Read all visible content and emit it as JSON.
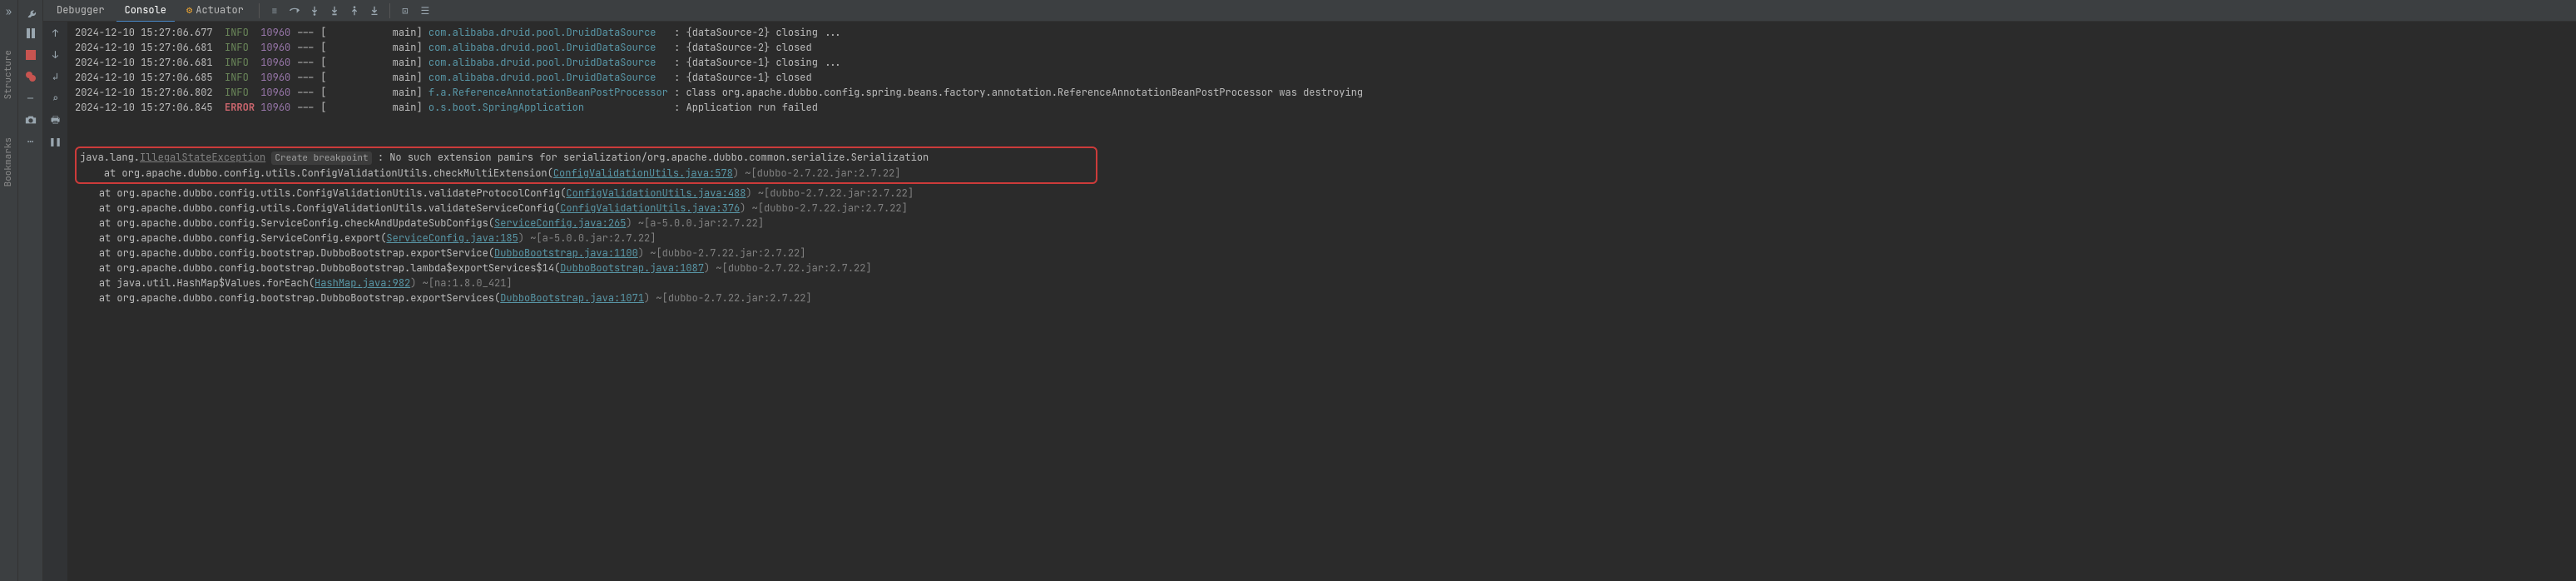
{
  "sidebar_vertical": {
    "structure": "Structure",
    "bookmarks": "Bookmarks"
  },
  "tabs": {
    "debugger": "Debugger",
    "console": "Console",
    "actuator": "Actuator"
  },
  "log": [
    {
      "ts": "2024-12-10 15:27:06.677",
      "level": "INFO",
      "pid": "10960",
      "thread": "main",
      "logger": "com.alibaba.druid.pool.DruidDataSource",
      "msg": "{dataSource-2} closing ..."
    },
    {
      "ts": "2024-12-10 15:27:06.681",
      "level": "INFO",
      "pid": "10960",
      "thread": "main",
      "logger": "com.alibaba.druid.pool.DruidDataSource",
      "msg": "{dataSource-2} closed"
    },
    {
      "ts": "2024-12-10 15:27:06.681",
      "level": "INFO",
      "pid": "10960",
      "thread": "main",
      "logger": "com.alibaba.druid.pool.DruidDataSource",
      "msg": "{dataSource-1} closing ..."
    },
    {
      "ts": "2024-12-10 15:27:06.685",
      "level": "INFO",
      "pid": "10960",
      "thread": "main",
      "logger": "com.alibaba.druid.pool.DruidDataSource",
      "msg": "{dataSource-1} closed"
    },
    {
      "ts": "2024-12-10 15:27:06.802",
      "level": "INFO",
      "pid": "10960",
      "thread": "main",
      "logger": "f.a.ReferenceAnnotationBeanPostProcessor",
      "msg": "class org.apache.dubbo.config.spring.beans.factory.annotation.ReferenceAnnotationBeanPostProcessor was destroying"
    },
    {
      "ts": "2024-12-10 15:27:06.845",
      "level": "ERROR",
      "pid": "10960",
      "thread": "main",
      "logger": "o.s.boot.SpringApplication",
      "msg": "Application run failed"
    }
  ],
  "exception": {
    "prefix": "java.lang.",
    "name": "IllegalStateException",
    "breakpoint": "Create breakpoint",
    "message": ": No such extension pamirs for serialization/org.apache.dubbo.common.serialize.Serialization",
    "first_frame_pre": "at org.apache.dubbo.config.utils.ConfigValidationUtils.checkMultiExtension(",
    "first_frame_link": "ConfigValidationUtils.java:578",
    "first_frame_post": ") ~[dubbo-2.7.22.jar:2.7.22]"
  },
  "stack": [
    {
      "pre": "at org.apache.dubbo.config.utils.ConfigValidationUtils.validateProtocolConfig(",
      "link": "ConfigValidationUtils.java:488",
      "post": ") ~[dubbo-2.7.22.jar:2.7.22]"
    },
    {
      "pre": "at org.apache.dubbo.config.utils.ConfigValidationUtils.validateServiceConfig(",
      "link": "ConfigValidationUtils.java:376",
      "post": ") ~[dubbo-2.7.22.jar:2.7.22]"
    },
    {
      "pre": "at org.apache.dubbo.config.ServiceConfig.checkAndUpdateSubConfigs(",
      "link": "ServiceConfig.java:265",
      "post": ") ~[a-5.0.0.jar:2.7.22]"
    },
    {
      "pre": "at org.apache.dubbo.config.ServiceConfig.export(",
      "link": "ServiceConfig.java:185",
      "post": ") ~[a-5.0.0.jar:2.7.22]"
    },
    {
      "pre": "at org.apache.dubbo.config.bootstrap.DubboBootstrap.exportService(",
      "link": "DubboBootstrap.java:1100",
      "post": ") ~[dubbo-2.7.22.jar:2.7.22]"
    },
    {
      "pre": "at org.apache.dubbo.config.bootstrap.DubboBootstrap.lambda$exportServices$14(",
      "link": "DubboBootstrap.java:1087",
      "post": ") ~[dubbo-2.7.22.jar:2.7.22]"
    },
    {
      "pre": "at java.util.HashMap$Values.forEach(",
      "link": "HashMap.java:982",
      "post": ") ~[na:1.8.0_421]"
    },
    {
      "pre": "at org.apache.dubbo.config.bootstrap.DubboBootstrap.exportServices(",
      "link": "DubboBootstrap.java:1071",
      "post": ") ~[dubbo-2.7.22.jar:2.7.22]"
    }
  ],
  "icon_glyphs": {
    "chevrons": "»",
    "wrench": "🔧",
    "up": "↑",
    "down": "↓",
    "pause": "❚❚",
    "box": "□",
    "dot": "●",
    "line": "—",
    "camera": "📷",
    "horiz": "≡",
    "download": "↧",
    "downloads": "↧ ↧ ↧",
    "step-in": "↴",
    "step-out": "↳",
    "divider": "|",
    "stack": "☰"
  }
}
